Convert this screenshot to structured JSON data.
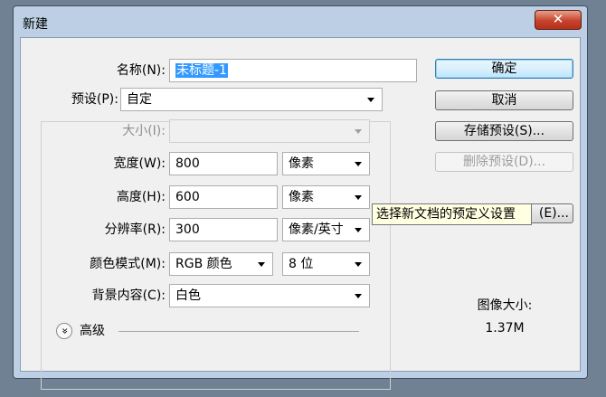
{
  "window": {
    "title": "新建",
    "close_glyph": "✕"
  },
  "form": {
    "name_label": "名称(N):",
    "name_value": "未标题-1",
    "preset_label": "预设(P):",
    "preset_value": "自定",
    "size_label": "大小(I):",
    "size_value": "",
    "width_label": "宽度(W):",
    "width_value": "800",
    "width_unit": "像素",
    "height_label": "高度(H):",
    "height_value": "600",
    "height_unit": "像素",
    "resolution_label": "分辨率(R):",
    "resolution_value": "300",
    "resolution_unit": "像素/英寸",
    "colormode_label": "颜色模式(M):",
    "colormode_value": "RGB 颜色",
    "bitdepth_value": "8 位",
    "background_label": "背景内容(C):",
    "background_value": "白色",
    "advanced_label": "高级",
    "advanced_glyph": "»"
  },
  "buttons": {
    "ok": "确定",
    "cancel": "取消",
    "save_preset": "存储预设(S)...",
    "delete_preset": "删除预设(D)...",
    "device_central_partial": "(E)..."
  },
  "tooltip": {
    "text": "选择新文档的预定义设置"
  },
  "image_size": {
    "label": "图像大小:",
    "value": "1.37M"
  }
}
